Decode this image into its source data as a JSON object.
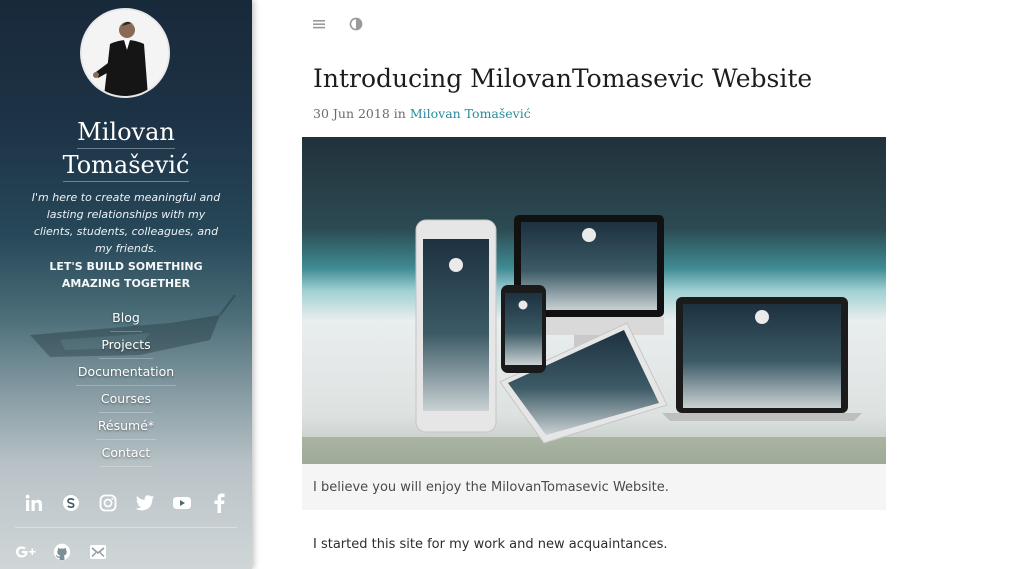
{
  "sidebar": {
    "site_title_line1": "Milovan",
    "site_title_line2": "Tomašević",
    "tagline": "I'm here to create meaningful and lasting relationships with my clients, students, colleagues, and my friends.",
    "cta": "LET'S BUILD SOMETHING AMAZING TOGETHER",
    "nav": [
      {
        "label": "Blog"
      },
      {
        "label": "Projects"
      },
      {
        "label": "Documentation"
      },
      {
        "label": "Courses"
      },
      {
        "label": "Résumé*"
      },
      {
        "label": "Contact"
      }
    ],
    "social_icons_row1": [
      "linkedin-icon",
      "skype-icon",
      "instagram-icon",
      "twitter-icon",
      "youtube-icon",
      "facebook-icon"
    ],
    "social_icons_row2": [
      "google-plus-icon",
      "github-icon",
      "email-icon"
    ]
  },
  "toolbar": {
    "icons": [
      "menu-icon",
      "contrast-icon"
    ]
  },
  "post": {
    "title": "Introducing MilovanTomasevic Website",
    "date": "30 Jun 2018",
    "in_word": "in",
    "author": "Milovan Tomašević",
    "image_caption": "I believe you will enjoy the MilovanTomasevic Website.",
    "body_first_line": "I started this site for my work and new acquaintances."
  },
  "colors": {
    "accent": "#2a8c9c",
    "sidebar_top": "#18293a",
    "title_text": "#1d1d1d"
  }
}
